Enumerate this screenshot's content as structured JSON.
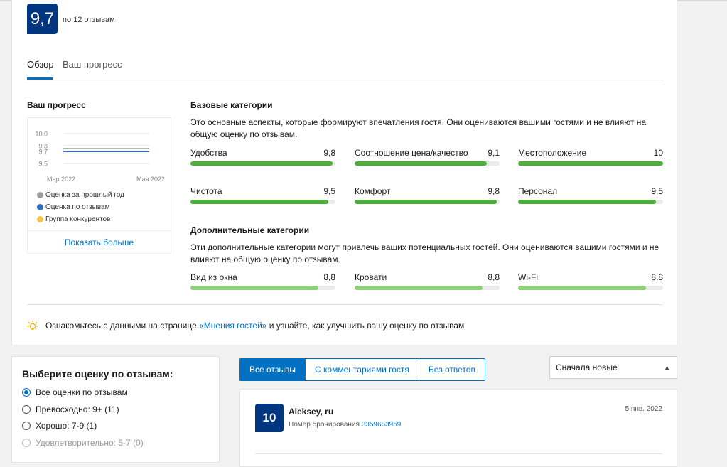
{
  "summary": {
    "score": "9,7",
    "count_text": "по 12 отзывам"
  },
  "tabs": [
    {
      "label": "Обзор"
    },
    {
      "label": "Ваш прогресс"
    }
  ],
  "progress": {
    "title": "Ваш прогресс",
    "chart_data": {
      "type": "line",
      "y_ticks": [
        "10.0",
        "9.8",
        "9.7",
        "9.5"
      ],
      "x_ticks": [
        "Мар 2022",
        "Мая 2022"
      ],
      "ylim": [
        9.5,
        10.0
      ],
      "series": [
        {
          "name": "Оценка за прошлый год",
          "color": "#9e9e9e",
          "values": [
            9.75,
            9.75
          ]
        },
        {
          "name": "Оценка по отзывам",
          "color": "#2f6fc4",
          "values": [
            9.7,
            9.7
          ]
        },
        {
          "name": "Группа конкурентов",
          "color": "#f5c342",
          "values": []
        }
      ]
    },
    "show_more": "Показать больше"
  },
  "base": {
    "title": "Базовые категории",
    "description": "Это основные аспекты, которые формируют впечатления гостя. Они оцениваются вашими гостями и не влияют на общую оценку по отзывам.",
    "items": [
      {
        "label": "Удобства",
        "value": "9,8",
        "score": 9.8
      },
      {
        "label": "Соотношение цена/качество",
        "value": "9,1",
        "score": 9.1
      },
      {
        "label": "Местоположение",
        "value": "10",
        "score": 10
      },
      {
        "label": "Чистота",
        "value": "9,5",
        "score": 9.5
      },
      {
        "label": "Комфорт",
        "value": "9,8",
        "score": 9.8
      },
      {
        "label": "Персонал",
        "value": "9,5",
        "score": 9.5
      }
    ]
  },
  "extra": {
    "title": "Дополнительные категории",
    "description": "Эти дополнительные категории могут привлечь ваших потенциальных гостей. Они оцениваются вашими гостями и не влияют на общую оценку по отзывам.",
    "items": [
      {
        "label": "Вид из окна",
        "value": "8,8",
        "score": 8.8
      },
      {
        "label": "Кровати",
        "value": "8,8",
        "score": 8.8
      },
      {
        "label": "Wi-Fi",
        "value": "8,8",
        "score": 8.8
      }
    ]
  },
  "tip": {
    "before": "Ознакомьтесь с данными на странице ",
    "link": "«Мнения гостей»",
    "after": " и узнайте, как улучшить вашу оценку по отзывам",
    "icon": "lightbulb-icon"
  },
  "filter": {
    "title": "Выберите оценку по отзывам:",
    "options": [
      {
        "label": "Все оценки по отзывам",
        "selected": true,
        "disabled": false
      },
      {
        "label": "Превосходно: 9+ (11)",
        "selected": false,
        "disabled": false
      },
      {
        "label": "Хорошо: 7-9 (1)",
        "selected": false,
        "disabled": false
      },
      {
        "label": "Удовлетворительно: 5-7 (0)",
        "selected": false,
        "disabled": true
      }
    ]
  },
  "review_tabs": [
    {
      "label": "Все отзывы"
    },
    {
      "label": "С комментариями гостя"
    },
    {
      "label": "Без ответов"
    }
  ],
  "sort": {
    "label": "Сначала новые"
  },
  "review": {
    "score": "10",
    "name": "Aleksey, ru",
    "booking_label": "Номер бронирования",
    "booking_number": "3359663959",
    "date": "5 янв. 2022"
  }
}
